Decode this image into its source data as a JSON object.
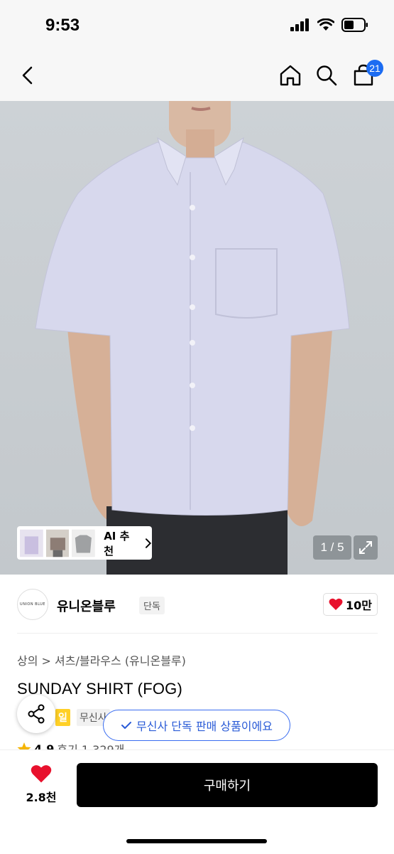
{
  "status_bar": {
    "time": "9:53"
  },
  "nav": {
    "cart_count": "21"
  },
  "hero": {
    "counter": "1 / 5",
    "ai_label": "AI 추천"
  },
  "brand": {
    "logo_text": "UNION BLUE",
    "name": "유니온블루",
    "tag": "단독",
    "likes": "10만"
  },
  "product": {
    "breadcrumb": "상의 > 셔츠/블라우스 (유니온블루)",
    "title": "SUNDAY SHIRT (FOG)",
    "sale_badge": "일",
    "musinsa_tag": "무신사",
    "rating": "4.9",
    "reviews": "후기 1,329개"
  },
  "tooltip": {
    "text": "무신사 단독 판매 상품이에요"
  },
  "bottom": {
    "wish_count": "2.8천",
    "buy_label": "구매하기"
  },
  "colors": {
    "accent": "#1c6cf2",
    "heart": "#e8112d",
    "sale": "#ffd026"
  }
}
